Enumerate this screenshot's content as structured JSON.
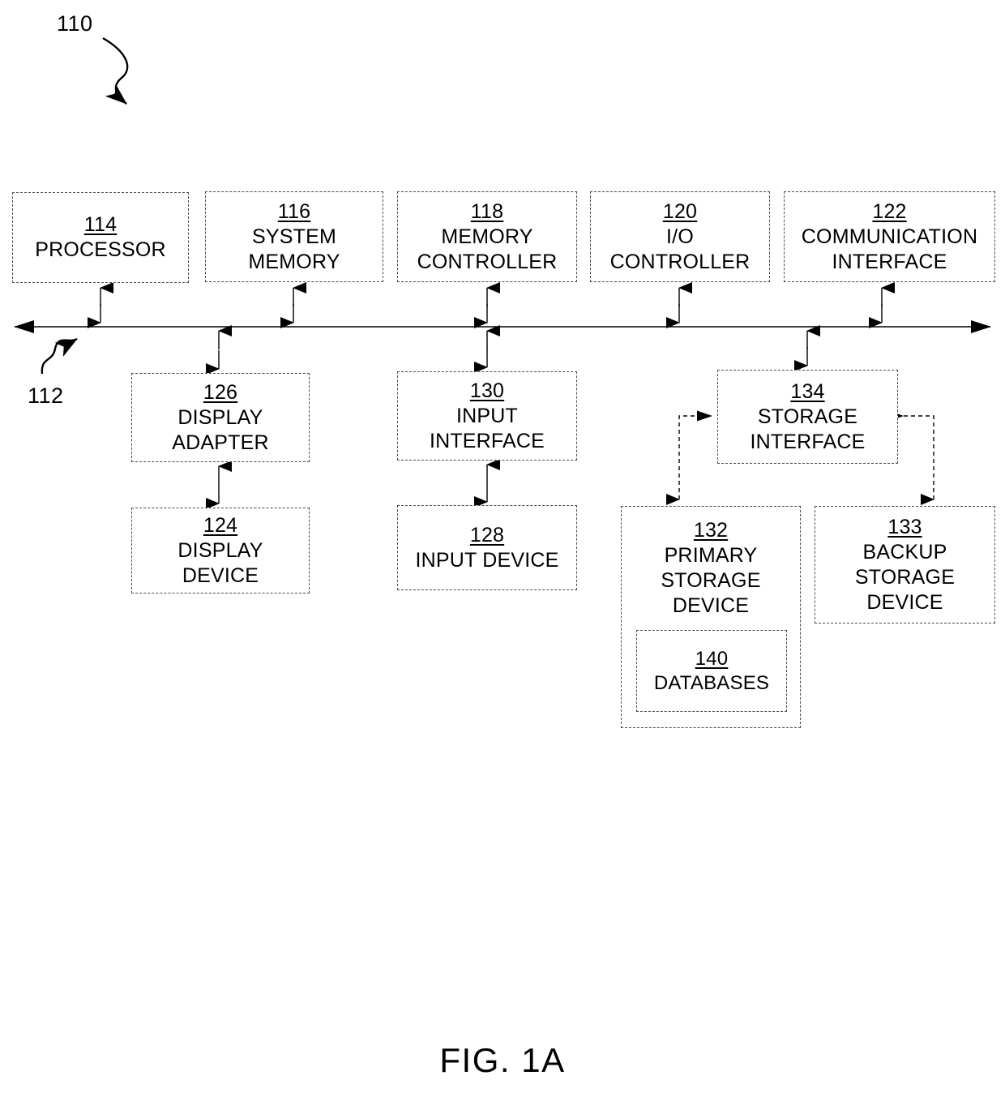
{
  "figure": {
    "caption": "FIG. 1A",
    "system_ref": "110",
    "bus_ref": "112"
  },
  "nodes": {
    "processor": {
      "ref": "114",
      "label": "PROCESSOR"
    },
    "system_memory": {
      "ref": "116",
      "label": "SYSTEM\nMEMORY"
    },
    "memory_controller": {
      "ref": "118",
      "label": "MEMORY\nCONTROLLER"
    },
    "io_controller": {
      "ref": "120",
      "label": "I/O\nCONTROLLER"
    },
    "communication_interface": {
      "ref": "122",
      "label": "COMMUNICATION\nINTERFACE"
    },
    "display_adapter": {
      "ref": "126",
      "label": "DISPLAY\nADAPTER"
    },
    "input_interface": {
      "ref": "130",
      "label": "INPUT\nINTERFACE"
    },
    "storage_interface": {
      "ref": "134",
      "label": "STORAGE\nINTERFACE"
    },
    "display_device": {
      "ref": "124",
      "label": "DISPLAY\nDEVICE"
    },
    "input_device": {
      "ref": "128",
      "label": "INPUT DEVICE"
    },
    "primary_storage_device": {
      "ref": "132",
      "label": "PRIMARY\nSTORAGE\nDEVICE"
    },
    "backup_storage_device": {
      "ref": "133",
      "label": "BACKUP\nSTORAGE\nDEVICE"
    },
    "databases": {
      "ref": "140",
      "label": "DATABASES"
    }
  },
  "colors": {
    "line": "#000000",
    "box_border": "#3c3c3c",
    "background": "#ffffff"
  }
}
